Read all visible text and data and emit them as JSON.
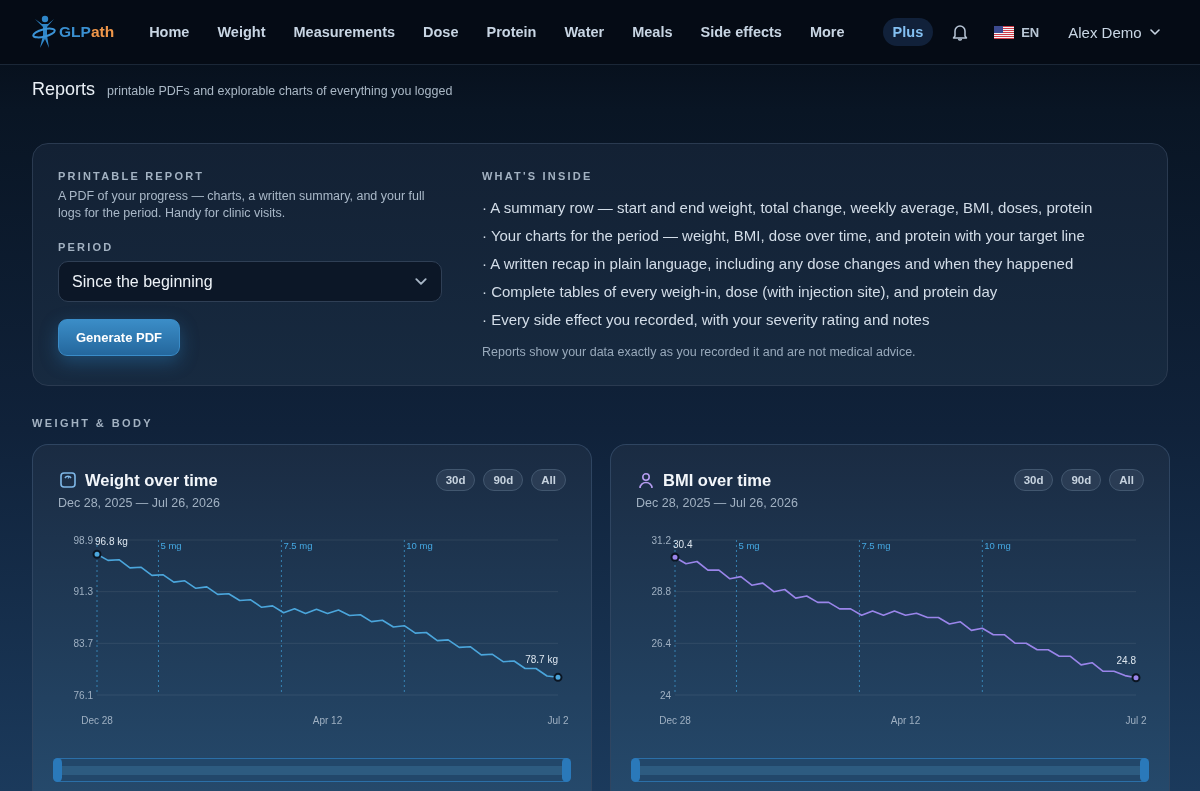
{
  "header": {
    "logo": {
      "primary": "GLP",
      "accent": "ath"
    },
    "nav": [
      "Home",
      "Weight",
      "Measurements",
      "Dose",
      "Protein",
      "Water",
      "Meals",
      "Side effects",
      "More"
    ],
    "plus": "Plus",
    "language": "EN",
    "user": "Alex Demo"
  },
  "page": {
    "title": "Reports",
    "subtitle": "printable PDFs and explorable charts of everything you logged"
  },
  "report_card": {
    "heading": "PRINTABLE REPORT",
    "description": "A PDF of your progress — charts, a written summary, and your full logs for the period. Handy for clinic visits.",
    "period_label": "PERIOD",
    "period_value": "Since the beginning",
    "button": "Generate PDF",
    "inside_heading": "WHAT'S INSIDE",
    "inside_items": [
      "· A summary row — start and end weight, total change, weekly average, BMI, doses, protein",
      "· Your charts for the period — weight, BMI, dose over time, and protein with your target line",
      "· A written recap in plain language, including any dose changes and when they happened",
      "· Complete tables of every weigh-in, dose (with injection site), and protein day",
      "· Every side effect you recorded, with your severity rating and notes"
    ],
    "note": "Reports show your data exactly as you recorded it and are not medical advice."
  },
  "section_label": "WEIGHT & BODY",
  "charts": [
    {
      "kind": "weight",
      "title": "Weight over time",
      "date_range": "Dec 28, 2025 — Jul 26, 2026",
      "ranges": [
        {
          "label": "30d",
          "selected": false
        },
        {
          "label": "90d",
          "selected": false
        },
        {
          "label": "All",
          "selected": false
        }
      ],
      "dose_markers": [
        {
          "label": "5 mg"
        },
        {
          "label": "7.5 mg"
        },
        {
          "label": "10 mg"
        }
      ],
      "chart_data": {
        "type": "line",
        "grid": true,
        "ylim": [
          76.1,
          98.9
        ],
        "yticks": [
          98.9,
          91.3,
          83.7,
          76.1
        ],
        "categories": [
          "Dec 28",
          null,
          null,
          null,
          null,
          null,
          null,
          null,
          null,
          null,
          null,
          null,
          null,
          null,
          null,
          null,
          null,
          null,
          null,
          null,
          null,
          "Apr 12",
          null,
          null,
          null,
          null,
          null,
          null,
          null,
          null,
          null,
          null,
          null,
          null,
          null,
          null,
          null,
          null,
          null,
          null,
          null,
          null,
          "Jul 2"
        ],
        "series": [
          {
            "color": "#4ba6dc",
            "values": [
              96.8,
              95.9,
              96.0,
              94.8,
              94.9,
              93.7,
              93.8,
              92.7,
              92.9,
              91.8,
              92.0,
              90.9,
              91.0,
              90.0,
              90.1,
              89.0,
              89.2,
              88.2,
              88.8,
              88.1,
              88.7,
              88.1,
              88.6,
              87.8,
              87.9,
              86.9,
              87.1,
              86.1,
              86.3,
              85.2,
              85.3,
              84.1,
              84.2,
              83.1,
              83.2,
              82.0,
              82.1,
              81.0,
              81.1,
              80.0,
              80.0,
              78.9,
              78.7
            ]
          }
        ],
        "annotations": [
          {
            "x": "Dec 28",
            "y": 96.8,
            "text": "96.8 kg"
          },
          {
            "x": "Jul 2",
            "y": 78.7,
            "text": "78.7 kg"
          }
        ]
      }
    },
    {
      "kind": "bmi",
      "title": "BMI over time",
      "date_range": "Dec 28, 2025 — Jul 26, 2026",
      "ranges": [
        {
          "label": "30d",
          "selected": false
        },
        {
          "label": "90d",
          "selected": false
        },
        {
          "label": "All",
          "selected": false
        }
      ],
      "dose_markers": [
        {
          "label": "5 mg"
        },
        {
          "label": "7.5 mg"
        },
        {
          "label": "10 mg"
        }
      ],
      "chart_data": {
        "type": "line",
        "grid": true,
        "ylim": [
          24,
          31.2
        ],
        "yticks": [
          31.2,
          28.8,
          26.4,
          24
        ],
        "categories": [
          "Dec 28",
          null,
          null,
          null,
          null,
          null,
          null,
          null,
          null,
          null,
          null,
          null,
          null,
          null,
          null,
          null,
          null,
          null,
          null,
          null,
          null,
          "Apr 12",
          null,
          null,
          null,
          null,
          null,
          null,
          null,
          null,
          null,
          null,
          null,
          null,
          null,
          null,
          null,
          null,
          null,
          null,
          null,
          null,
          "Jul 2"
        ],
        "series": [
          {
            "color": "#9a85ea",
            "values": [
              30.4,
              30.1,
              30.2,
              29.8,
              29.8,
              29.4,
              29.5,
              29.1,
              29.2,
              28.8,
              28.9,
              28.5,
              28.6,
              28.3,
              28.3,
              28.0,
              28.0,
              27.7,
              27.9,
              27.7,
              27.9,
              27.7,
              27.8,
              27.6,
              27.6,
              27.3,
              27.4,
              27.0,
              27.1,
              26.8,
              26.8,
              26.4,
              26.4,
              26.1,
              26.1,
              25.8,
              25.8,
              25.4,
              25.5,
              25.1,
              25.1,
              24.9,
              24.8
            ]
          }
        ],
        "annotations": [
          {
            "x": "Dec 28",
            "y": 30.4,
            "text": "30.4"
          },
          {
            "x": "Jul 2",
            "y": 24.8,
            "text": "24.8"
          }
        ]
      }
    }
  ]
}
